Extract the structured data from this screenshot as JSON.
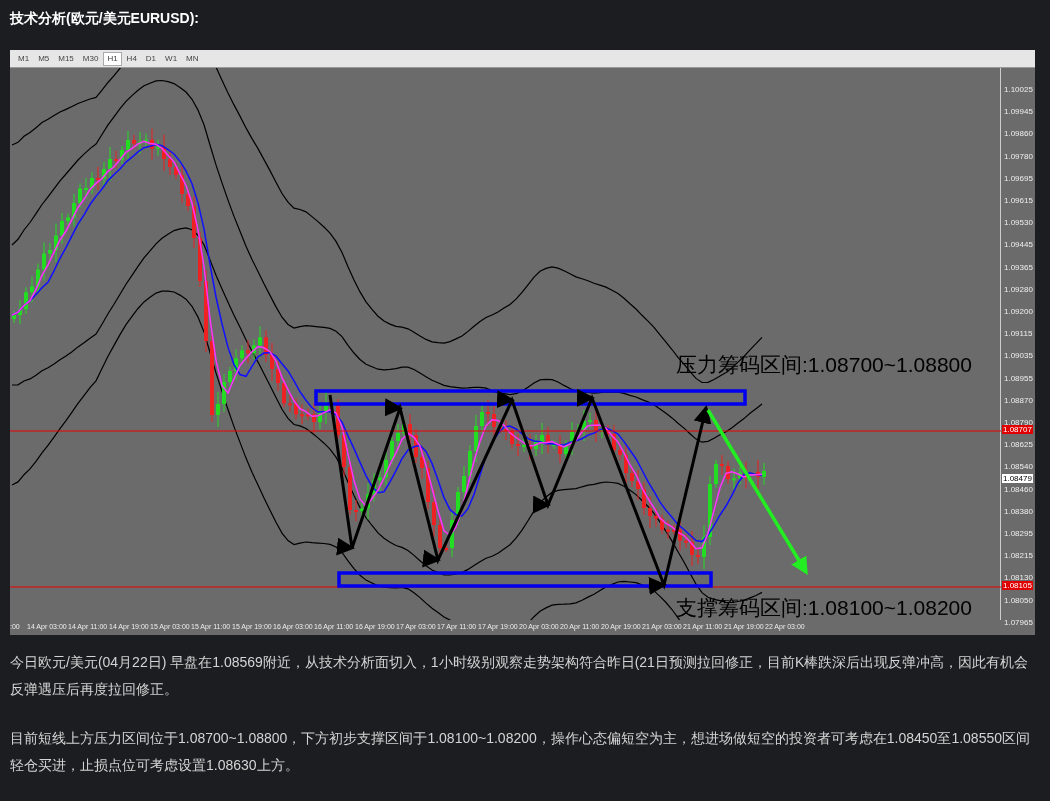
{
  "title": "技术分析(欧元/美元EURUSD):",
  "chart": {
    "timeframes": [
      {
        "label": "M1",
        "selected": false
      },
      {
        "label": "M5",
        "selected": false
      },
      {
        "label": "M15",
        "selected": false
      },
      {
        "label": "M30",
        "selected": false
      },
      {
        "label": "H1",
        "selected": true
      },
      {
        "label": "H4",
        "selected": false
      },
      {
        "label": "D1",
        "selected": false
      },
      {
        "label": "W1",
        "selected": false
      },
      {
        "label": "MN",
        "selected": false
      }
    ],
    "annotations": [
      {
        "kind": "resistance",
        "text": "压力筹码区间:1.08700~1.08800"
      },
      {
        "kind": "support",
        "text": "支撑筹码区间:1.08100~1.08200"
      }
    ],
    "price_axis": [
      "1.10025",
      "1.09945",
      "1.09860",
      "1.09780",
      "1.09695",
      "1.09615",
      "1.09530",
      "1.09445",
      "1.09365",
      "1.09280",
      "1.09200",
      "1.09115",
      "1.09035",
      "1.08955",
      "1.08870",
      "1.08790",
      "1.08625",
      "1.08540",
      "1.08460",
      "1.08380",
      "1.08295",
      "1.08215",
      "1.08130",
      "1.08050",
      "1.07965"
    ],
    "price_markers": [
      {
        "kind": "level_line",
        "text": "1.08707"
      },
      {
        "kind": "bid",
        "text": "1.08479"
      },
      {
        "kind": "level_line",
        "text": "1.08105"
      }
    ],
    "time_axis": [
      ":00",
      "14 Apr 03:00",
      "14 Apr 11:00",
      "14 Apr 19:00",
      "15 Apr 03:00",
      "15 Apr 11:00",
      "15 Apr 19:00",
      "16 Apr 03:00",
      "16 Apr 11:00",
      "16 Apr 19:00",
      "17 Apr 03:00",
      "17 Apr 11:00",
      "17 Apr 19:00",
      "20 Apr 03:00",
      "20 Apr 11:00",
      "20 Apr 19:00",
      "21 Apr 03:00",
      "21 Apr 11:00",
      "21 Apr 19:00",
      "22 Apr 03:00"
    ]
  },
  "paragraphs": [
    "今日欧元/美元(04月22日) 早盘在1.08569附近，从技术分析面切入，1小时级别观察走势架构符合昨日(21日预测拉回修正，目前K棒跌深后出现反弹冲高，因此有机会反弹遇压后再度拉回修正。",
    "目前短线上方压力区间位于1.08700~1.08800，下方初步支撑区间于1.08100~1.08200，操作心态偏短空为主，想进场做短空的投资者可考虑在1.08450至1.08550区间轻仓买进，止损点位可考虑设置1.08630上方。"
  ]
}
